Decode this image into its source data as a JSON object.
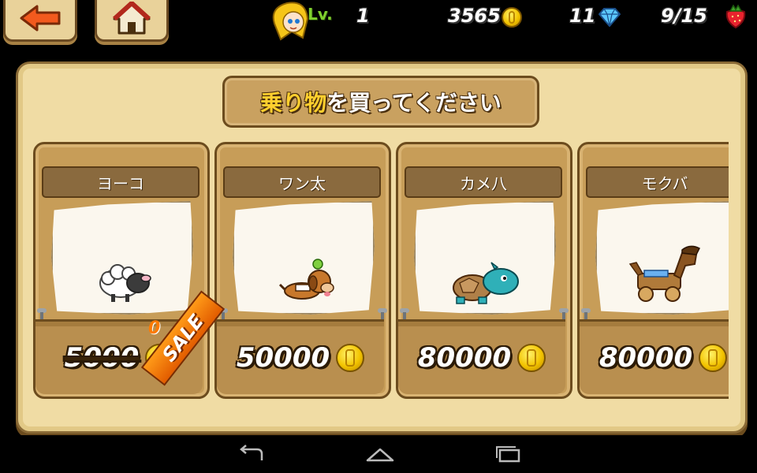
{
  "hud": {
    "level_label": "Lv.",
    "level": "1",
    "coins": "3565",
    "gems": "11",
    "stamina": "9/15",
    "icons": [
      "back-arrow-icon",
      "home-icon",
      "player-avatar",
      "coin-icon",
      "diamond-icon",
      "strawberry-icon"
    ]
  },
  "title": {
    "highlight": "乗り物",
    "rest": "を買ってください"
  },
  "rides": [
    {
      "name": "ヨーコ",
      "price": "5000",
      "on_sale": true,
      "sale_label": "SALE",
      "sale_count": "0",
      "creature": "sheep"
    },
    {
      "name": "ワン太",
      "price": "50000",
      "on_sale": false,
      "creature": "dog"
    },
    {
      "name": "カメ八",
      "price": "80000",
      "on_sale": false,
      "creature": "turtle"
    },
    {
      "name": "モクバ",
      "price": "80000",
      "on_sale": false,
      "creature": "wooden-horse"
    }
  ],
  "colors": {
    "board": "#f0dca4",
    "card": "#c79d58",
    "title_highlight": "#ffcf2e",
    "sale": "#ff8c00"
  },
  "navbar": {
    "icons": [
      "back-nav-icon",
      "home-nav-icon",
      "recents-nav-icon"
    ]
  }
}
